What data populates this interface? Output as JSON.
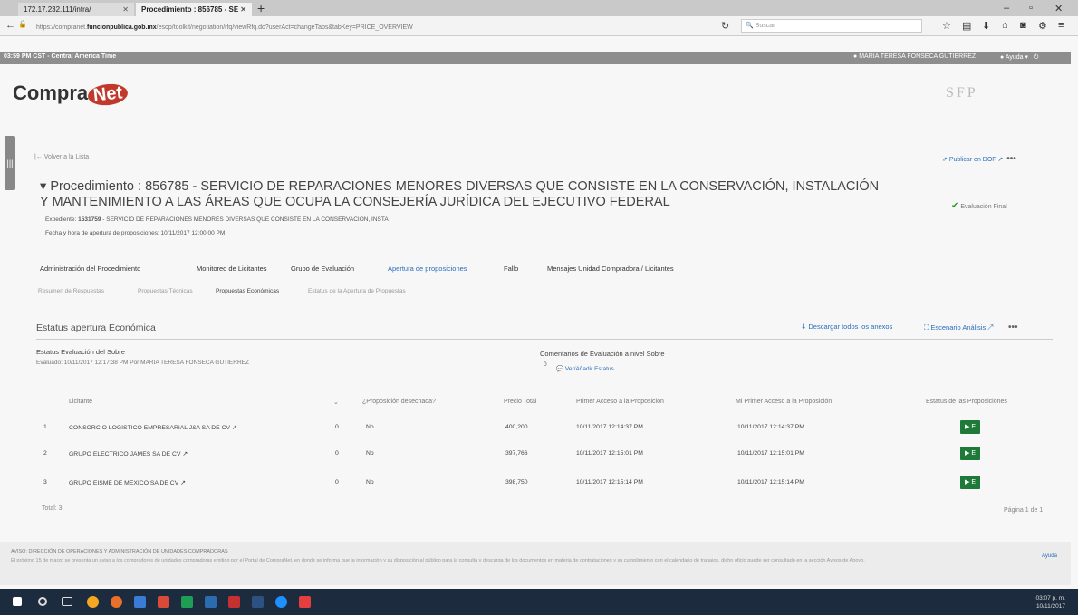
{
  "browser": {
    "tabs": [
      {
        "label": "172.17.232.111/intra/"
      },
      {
        "label": "Procedimiento : 856785 - SE"
      }
    ],
    "url_prefix": "https://compranet.",
    "url_domain": "funcionpublica.gob.mx",
    "url_rest": "/esop/toolkit/negotiation/rfq/viewRfq.do?userAct=changeTabs&tabKey=PRICE_OVERVIEW",
    "search_placeholder": "Buscar"
  },
  "appbar": {
    "time": "03:59 PM CST - Central America Time",
    "user": "MARIA TERESA FONSECA GUTIERREZ",
    "help": "Ayuda"
  },
  "header": {
    "logo_left": "Compra",
    "logo_right": "Net",
    "sfp": "SFP"
  },
  "nav": {
    "back": "Volver a la Lista",
    "publicar": "Publicar en DOF"
  },
  "procedure": {
    "title": "Procedimiento : 856785 - SERVICIO DE REPARACIONES MENORES DIVERSAS QUE CONSISTE EN LA CONSERVACIÓN, INSTALACIÓN Y MANTENIMIENTO A LAS ÁREAS QUE OCUPA LA CONSEJERÍA JURÍDICA DEL EJECUTIVO FEDERAL",
    "status": "Evaluación Final",
    "expediente_label": "Expediente:",
    "expediente_num": "1531759",
    "expediente_text": "- SERVICIO DE REPARACIONES MENORES DIVERSAS QUE CONSISTE EN LA CONSERVACIÓN, INSTA",
    "fecha": "Fecha y hora de apertura de proposiciones: 10/11/2017 12:00:00 PM"
  },
  "tabs": [
    {
      "label": "Administración del Procedimiento"
    },
    {
      "label": "Monitoreo de Licitantes"
    },
    {
      "label": "Grupo de Evaluación"
    },
    {
      "label": "Apertura de proposiciones"
    },
    {
      "label": "Fallo"
    },
    {
      "label": "Mensajes Unidad Compradora / Licitantes"
    }
  ],
  "subtabs": [
    {
      "label": "Resumen de Respuestas"
    },
    {
      "label": "Propuestas Técnicas"
    },
    {
      "label": "Propuestas Económicas"
    },
    {
      "label": "Estatus de la Apertura de Propuestas"
    }
  ],
  "section": {
    "title": "Estatus apertura Económica",
    "download": "Descargar todos los anexos",
    "escenario": "Escenario Análisis",
    "estatus_sobre_label": "Estatus Evaluación del Sobre",
    "evaluado": "Evaluado: 10/11/2017 12:17:38 PM  Por MARIA TERESA FONSECA GUTIERREZ",
    "comentarios_label": "Comentarios de Evaluación a nivel Sobre",
    "comentarios_count": "0",
    "ver_estatus": "Ver/Añadir Estatus"
  },
  "table": {
    "headers": [
      "Licitante",
      "¿Proposición desechada?",
      "Precio Total",
      "Primer Acceso a la Proposición",
      "Mi Primer Acceso a la Proposición",
      "Estatus de las Proposiciones"
    ],
    "rows": [
      {
        "n": "1",
        "licitante": "CONSORCIO LOGISTICO EMPRESARIAL J&A SA DE CV",
        "count": "0",
        "desechada": "No",
        "precio": "400,200",
        "primer": "10/11/2017 12:14:37 PM",
        "mi_primer": "10/11/2017 12:14:37 PM",
        "estatus": "E"
      },
      {
        "n": "2",
        "licitante": "GRUPO ELECTRICO JAMES SA DE CV",
        "count": "0",
        "desechada": "No",
        "precio": "397,766",
        "primer": "10/11/2017 12:15:01 PM",
        "mi_primer": "10/11/2017 12:15:01 PM",
        "estatus": "E"
      },
      {
        "n": "3",
        "licitante": "GRUPO EISME DE MEXICO SA DE CV",
        "count": "0",
        "desechada": "No",
        "precio": "398,750",
        "primer": "10/11/2017 12:15:14 PM",
        "mi_primer": "10/11/2017 12:15:14 PM",
        "estatus": "E"
      }
    ],
    "total": "Total: 3",
    "pager": "Página 1 de 1"
  },
  "footer": {
    "line1": "AVISO: DIRECCIÓN DE OPERACIONES Y ADMINISTRACIÓN DE UNIDADES COMPRADORAS",
    "line2": "El próximo 15 de marzo se presenta un aviso a los compradores de unidades compradoras emitido por el Portal de CompraNet, en donde se informa que la información y su disposición al público para la consulta y descarga de los documentos en materia de contrataciones y su cumplimiento con el calendario de trabajos, dicho oficio puede ser consultado en la sección Avisos de Apoyo.",
    "ayuda": "Ayuda"
  },
  "taskbar": {
    "time": "03:07 p. m.",
    "date": "10/11/2017"
  },
  "colors": {
    "accent": "#2a6ebb",
    "badge": "#1f7a3a",
    "appbar": "#8e8e8e"
  }
}
